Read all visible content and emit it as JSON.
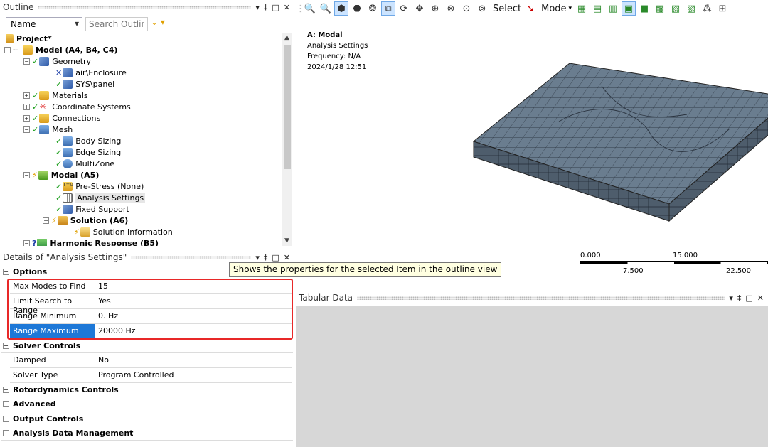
{
  "outline": {
    "title": "Outline",
    "controls": [
      "▾",
      "‡",
      "□",
      "✕"
    ],
    "name_filter": "Name",
    "search_placeholder": "Search Outline",
    "tree": [
      {
        "label": "Project*",
        "bold": true
      },
      {
        "label": "Model (A4, B4, C4)",
        "bold": true
      },
      {
        "label": "Geometry",
        "bold": false
      },
      {
        "label": "air\\Enclosure",
        "bold": false
      },
      {
        "label": "SYS\\panel",
        "bold": false
      },
      {
        "label": "Materials",
        "bold": false
      },
      {
        "label": "Coordinate Systems",
        "bold": false
      },
      {
        "label": "Connections",
        "bold": false
      },
      {
        "label": "Mesh",
        "bold": false
      },
      {
        "label": "Body Sizing",
        "bold": false
      },
      {
        "label": "Edge Sizing",
        "bold": false
      },
      {
        "label": "MultiZone",
        "bold": false
      },
      {
        "label": "Modal (A5)",
        "bold": true
      },
      {
        "label": "Pre-Stress (None)",
        "bold": false
      },
      {
        "label": "Analysis Settings",
        "bold": false
      },
      {
        "label": "Fixed Support",
        "bold": false
      },
      {
        "label": "Solution (A6)",
        "bold": true
      },
      {
        "label": "Solution Information",
        "bold": false
      },
      {
        "label": "Harmonic Response (B5)",
        "bold": true
      }
    ]
  },
  "details": {
    "title": "Details of \"Analysis Settings\"",
    "controls": [
      "▾",
      "‡",
      "□",
      "✕"
    ],
    "groups": {
      "options": "Options",
      "solver_controls": "Solver Controls",
      "rotordynamics": "Rotordynamics Controls",
      "advanced": "Advanced",
      "output": "Output Controls",
      "data_mgmt": "Analysis Data Management"
    },
    "rows": {
      "max_modes": {
        "key": "Max Modes to Find",
        "value": "15"
      },
      "limit_search": {
        "key": "Limit Search to Range",
        "value": "Yes"
      },
      "range_min": {
        "key": "Range Minimum",
        "value": "0. Hz"
      },
      "range_max": {
        "key": "Range Maximum",
        "value": "20000 Hz"
      },
      "damped": {
        "key": "Damped",
        "value": "No"
      },
      "solver_type": {
        "key": "Solver Type",
        "value": "Program Controlled"
      }
    }
  },
  "tooltip": "Shows the properties for the selected Item in the outline view",
  "toolbar": {
    "select_label": "Select",
    "mode_label": "Mode"
  },
  "graphics": {
    "title": "A: Modal",
    "subtitle": "Analysis Settings",
    "frequency": "Frequency: N/A",
    "date": "2024/1/28 12:51",
    "scale_labels": {
      "a": "0.000",
      "b": "15.000",
      "c": "7.500",
      "d": "22.500"
    }
  },
  "tabular": {
    "title": "Tabular Data",
    "controls": [
      "▾",
      "‡",
      "□",
      "✕"
    ]
  },
  "colors": {
    "selection_blue": "#1e78d7",
    "highlight_red": "#e82828",
    "mesh_fill": "#667788"
  }
}
